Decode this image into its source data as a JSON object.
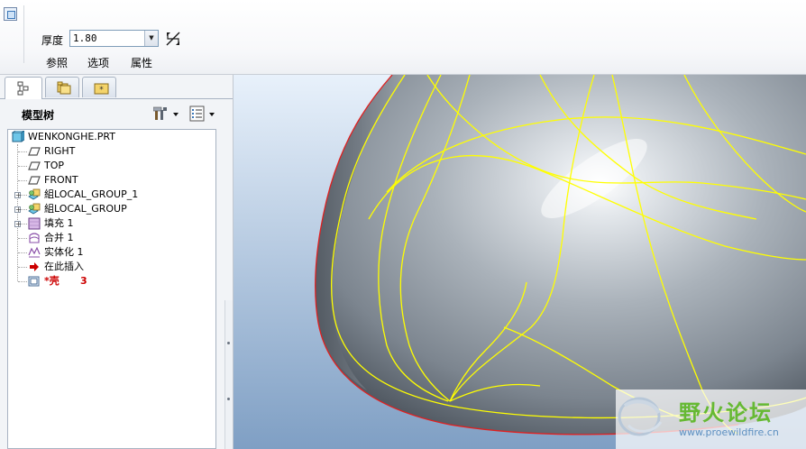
{
  "dashboard": {
    "thickness_label": "厚度",
    "thickness_value": "1.80",
    "tabs": [
      "参照",
      "选项",
      "属性"
    ]
  },
  "navigator": {
    "title": "模型树",
    "items": [
      {
        "label": "WENKONGHE.PRT",
        "icon": "part-icon"
      },
      {
        "label": "RIGHT",
        "icon": "datum-plane-icon"
      },
      {
        "label": "TOP",
        "icon": "datum-plane-icon"
      },
      {
        "label": "FRONT",
        "icon": "datum-plane-icon"
      },
      {
        "label": "組LOCAL_GROUP_1",
        "icon": "group-icon"
      },
      {
        "label": "組LOCAL_GROUP",
        "icon": "group-icon"
      },
      {
        "label": "填充 1",
        "icon": "fill-icon"
      },
      {
        "label": "合并 1",
        "icon": "merge-icon"
      },
      {
        "label": "实体化 1",
        "icon": "solidify-icon"
      },
      {
        "label": "在此插入",
        "icon": "insert-here-arrow-icon"
      },
      {
        "label": "*壳",
        "icon": "shell-icon"
      },
      {
        "label": "3",
        "icon": ""
      }
    ]
  },
  "watermark": {
    "title": "野火论坛",
    "url": "www.proewildfire.cn"
  },
  "colors": {
    "viewport_top": "#e7f1fb",
    "viewport_bottom": "#7a9ac0",
    "curve_yellow": "#ffff00",
    "edge_red": "#e02020",
    "insert_arrow": "#cc0000"
  }
}
